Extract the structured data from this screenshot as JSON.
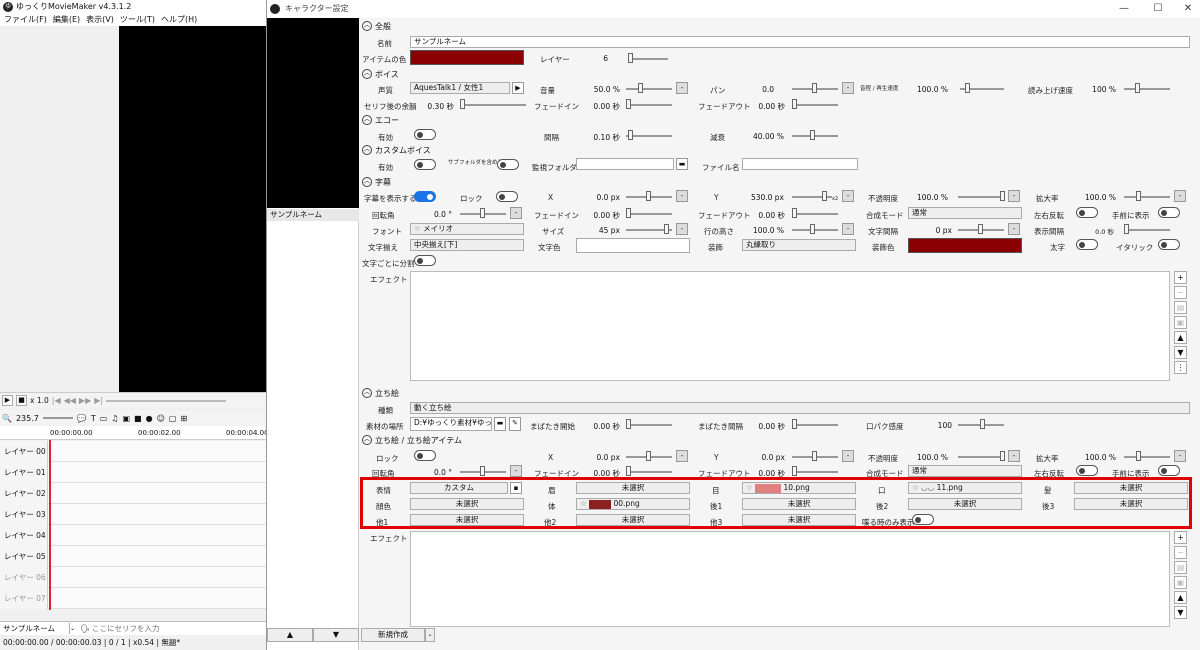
{
  "app": {
    "title": "ゆっくりMovieMaker v4.3.1.2",
    "menu": [
      "ファイル(F)",
      "編集(E)",
      "表示(V)",
      "ツール(T)",
      "ヘルプ(H)"
    ]
  },
  "player": {
    "speed": "x 1.0"
  },
  "timeline": {
    "zoom": "235.7",
    "ruler": [
      "00:00:00.00",
      "00:00:02.00",
      "00:00:04.00"
    ],
    "layers": [
      "レイヤー 00",
      "レイヤー 01",
      "レイヤー 02",
      "レイヤー 03",
      "レイヤー 04",
      "レイヤー 05",
      "レイヤー 06",
      "レイヤー 07"
    ],
    "char_select": "サンプルネーム",
    "serif_placeholder": "ここにセリフを入力"
  },
  "status": {
    "text": "00:00:00.00 / 00:00:00.03 | 0 / 1 | x0.54 | 無題*"
  },
  "dialog": {
    "title": "キャラクター設定",
    "char_item": "サンプルネーム",
    "up": "▲",
    "down": "▼",
    "new_label": "新規作成",
    "general": {
      "header": "全般",
      "name_label": "名前",
      "name": "サンプルネーム",
      "color_label": "アイテムの色",
      "color": "#8b0000",
      "layer_label": "レイヤー",
      "layer": "6"
    },
    "voice": {
      "header": "ボイス",
      "voice_label": "声質",
      "voice": "AquesTalk1 / 女性1",
      "volume_label": "音量",
      "volume": "50.0 %",
      "pan_label": "パン",
      "pan": "0.0",
      "pitch_label": "音程 / 再生速度",
      "pitch": "100.0 %",
      "speed_label": "読み上げ速度",
      "speed": "100 %",
      "margin_label": "セリフ後の余韻",
      "margin": "0.30 秒",
      "fadein_label": "フェードイン",
      "fadein": "0.00 秒",
      "fadeout_label": "フェードアウト",
      "fadeout": "0.00 秒"
    },
    "echo": {
      "header": "エコー",
      "enable_label": "有効",
      "interval_label": "間隔",
      "interval": "0.10 秒",
      "decay_label": "減衰",
      "decay": "40.00 %"
    },
    "custom": {
      "header": "カスタムボイス",
      "enable_label": "有効",
      "subfolder_label": "サブフォルダを含める",
      "watch_label": "監視フォルダ",
      "file_label": "ファイル名"
    },
    "subtitle": {
      "header": "字幕",
      "show_label": "字幕を表示する",
      "lock_label": "ロック",
      "x_label": "X",
      "x": "0.0 px",
      "y_label": "Y",
      "y": "530.0 px",
      "y_mult": "x2",
      "opacity_label": "不透明度",
      "opacity": "100.0 %",
      "zoom_label": "拡大率",
      "zoom": "100.0 %",
      "rot_label": "回転角",
      "rot": "0.0 °",
      "fadein_label": "フェードイン",
      "fadein": "0.00 秒",
      "fadeout_label": "フェードアウト",
      "fadeout": "0.00 秒",
      "blend_label": "合成モード",
      "blend": "通常",
      "flip_label": "左右反転",
      "front_label": "手前に表示",
      "font_label": "フォント",
      "font": "メイリオ",
      "size_label": "サイズ",
      "size": "45 px",
      "line_label": "行の高さ",
      "line": "100.0 %",
      "spacing_label": "文字間隔",
      "spacing": "0 px",
      "interval_label": "表示間隔",
      "interval": "0.0 秒",
      "align_label": "文字揃え",
      "align": "中央揃え[下]",
      "color_label": "文字色",
      "deco_label": "装飾",
      "deco": "丸縁取り",
      "decocolor_label": "装飾色",
      "decocolor": "#8b0000",
      "bold_label": "太字",
      "italic_label": "イタリック",
      "split_label": "文字ごとに分割",
      "effect_label": "エフェクト"
    },
    "tachie": {
      "header": "立ち絵",
      "type_label": "種類",
      "type": "動く立ち絵",
      "path_label": "素材の場所",
      "path": "D:¥ゆっくり素材¥ゆっくり",
      "blink_label": "まばたき開始",
      "blink": "0.00 秒",
      "blinkint_label": "まばたき間隔",
      "blinkint": "0.00 秒",
      "lip_label": "口パク感度",
      "lip": "100"
    },
    "tachie_item": {
      "header": "立ち絵 / 立ち絵アイテム",
      "lock_label": "ロック",
      "x_label": "X",
      "x": "0.0 px",
      "y_label": "Y",
      "y": "0.0 px",
      "opacity_label": "不透明度",
      "opacity": "100.0 %",
      "zoom_label": "拡大率",
      "zoom": "100.0 %",
      "rot_label": "回転角",
      "rot": "0.0 °",
      "fadein_label": "フェードイン",
      "fadein": "0.00 秒",
      "fadeout_label": "フェードアウト",
      "fadeout": "0.00 秒",
      "blend_label": "合成モード",
      "blend": "通常",
      "flip_label": "左右反転",
      "front_label": "手前に表示",
      "expr_label": "表情",
      "expr": "カスタム",
      "brow_label": "眉",
      "brow": "未選択",
      "eye_label": "目",
      "eye": "10.png",
      "mouth_label": "口",
      "mouth": "11.png",
      "hair_label": "髪",
      "hair": "未選択",
      "complexion_label": "顔色",
      "complexion": "未選択",
      "body_label": "体",
      "body": "00.png",
      "back1_label": "後1",
      "back1": "未選択",
      "back2_label": "後2",
      "back2": "未選択",
      "back3_label": "後3",
      "back3": "未選択",
      "other1_label": "他1",
      "other1": "未選択",
      "other2_label": "他2",
      "other2": "未選択",
      "other3_label": "他3",
      "other3": "未選択",
      "speak_only_label": "喋る時のみ表示",
      "effect_label": "エフェクト"
    }
  }
}
